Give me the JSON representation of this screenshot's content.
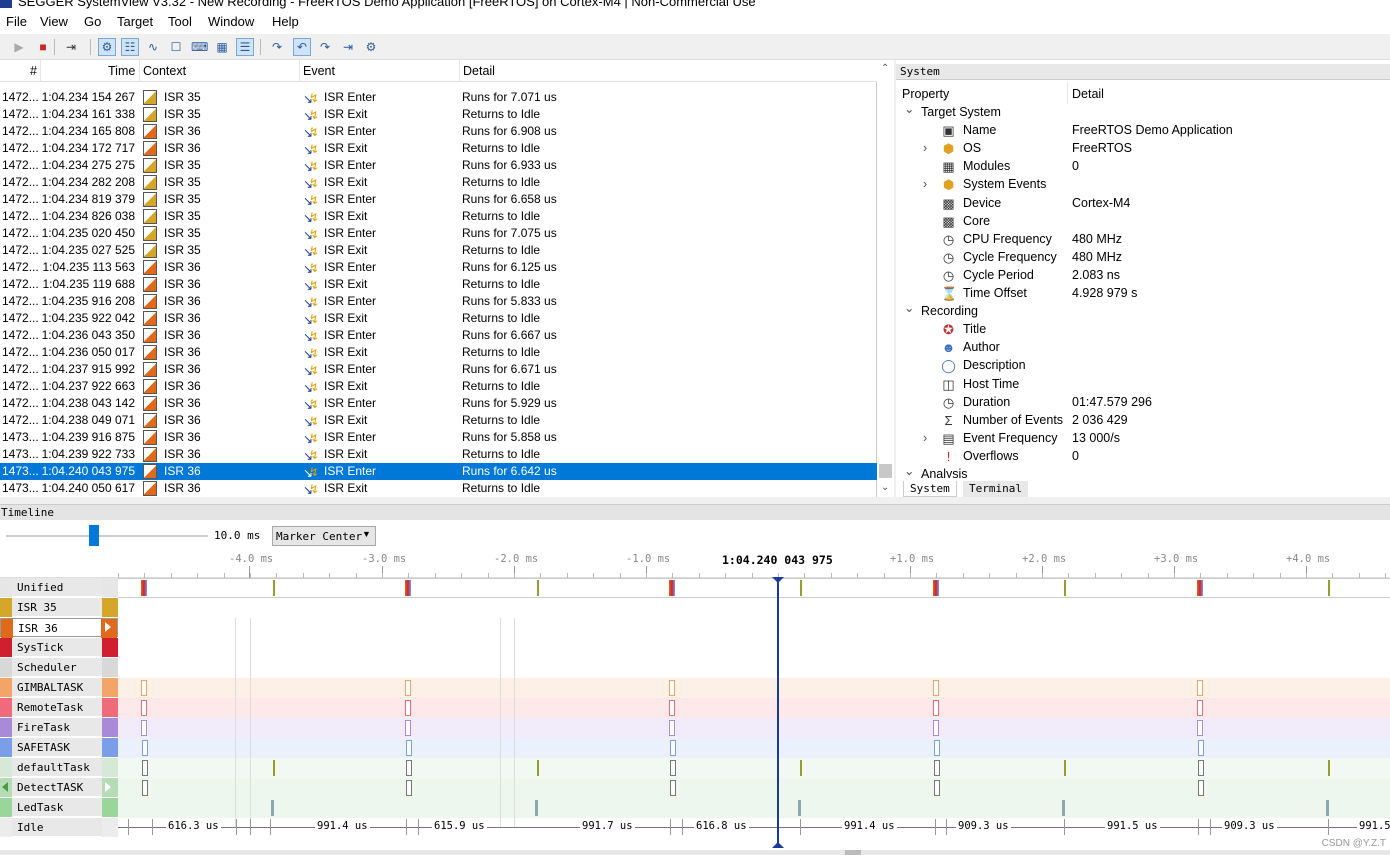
{
  "window": {
    "title": "SEGGER SystemView V3.32 - New Recording - FreeRTOS Demo Application [FreeRTOS] on Cortex-M4 | Non-Commercial Use"
  },
  "menu": [
    "File",
    "View",
    "Go",
    "Target",
    "Tool",
    "Window",
    "Help"
  ],
  "toolbar": [
    "play-icon",
    "stop-icon",
    "step-icon",
    "system-icon",
    "events-icon",
    "timeline-icon",
    "context-icon",
    "terminal-icon",
    "cpu-icon",
    "table-icon",
    "go-forward-icon",
    "go-prev-icon",
    "go-next-icon",
    "go-last-icon",
    "settings-icon"
  ],
  "events": {
    "columns": [
      "#",
      "Time",
      "Context",
      "Event",
      "Detail"
    ],
    "rows": [
      {
        "num": "1472...",
        "time": "1:04.234 154 267",
        "ctx": "ISR 35",
        "event": "ISR Enter",
        "detail": "Runs for 7.071 us"
      },
      {
        "num": "1472...",
        "time": "1:04.234 161 338",
        "ctx": "ISR 35",
        "event": "ISR Exit",
        "detail": "Returns to Idle"
      },
      {
        "num": "1472...",
        "time": "1:04.234 165 808",
        "ctx": "ISR 36",
        "event": "ISR Enter",
        "detail": "Runs for 6.908 us"
      },
      {
        "num": "1472...",
        "time": "1:04.234 172 717",
        "ctx": "ISR 36",
        "event": "ISR Exit",
        "detail": "Returns to Idle"
      },
      {
        "num": "1472...",
        "time": "1:04.234 275 275",
        "ctx": "ISR 35",
        "event": "ISR Enter",
        "detail": "Runs for 6.933 us"
      },
      {
        "num": "1472...",
        "time": "1:04.234 282 208",
        "ctx": "ISR 35",
        "event": "ISR Exit",
        "detail": "Returns to Idle"
      },
      {
        "num": "1472...",
        "time": "1:04.234 819 379",
        "ctx": "ISR 35",
        "event": "ISR Enter",
        "detail": "Runs for 6.658 us"
      },
      {
        "num": "1472...",
        "time": "1:04.234 826 038",
        "ctx": "ISR 35",
        "event": "ISR Exit",
        "detail": "Returns to Idle"
      },
      {
        "num": "1472...",
        "time": "1:04.235 020 450",
        "ctx": "ISR 35",
        "event": "ISR Enter",
        "detail": "Runs for 7.075 us"
      },
      {
        "num": "1472...",
        "time": "1:04.235 027 525",
        "ctx": "ISR 35",
        "event": "ISR Exit",
        "detail": "Returns to Idle"
      },
      {
        "num": "1472...",
        "time": "1:04.235 113 563",
        "ctx": "ISR 36",
        "event": "ISR Enter",
        "detail": "Runs for 6.125 us"
      },
      {
        "num": "1472...",
        "time": "1:04.235 119 688",
        "ctx": "ISR 36",
        "event": "ISR Exit",
        "detail": "Returns to Idle"
      },
      {
        "num": "1472...",
        "time": "1:04.235 916 208",
        "ctx": "ISR 36",
        "event": "ISR Enter",
        "detail": "Runs for 5.833 us"
      },
      {
        "num": "1472...",
        "time": "1:04.235 922 042",
        "ctx": "ISR 36",
        "event": "ISR Exit",
        "detail": "Returns to Idle"
      },
      {
        "num": "1472...",
        "time": "1:04.236 043 350",
        "ctx": "ISR 36",
        "event": "ISR Enter",
        "detail": "Runs for 6.667 us"
      },
      {
        "num": "1472...",
        "time": "1:04.236 050 017",
        "ctx": "ISR 36",
        "event": "ISR Exit",
        "detail": "Returns to Idle"
      },
      {
        "num": "1472...",
        "time": "1:04.237 915 992",
        "ctx": "ISR 36",
        "event": "ISR Enter",
        "detail": "Runs for 6.671 us"
      },
      {
        "num": "1472...",
        "time": "1:04.237 922 663",
        "ctx": "ISR 36",
        "event": "ISR Exit",
        "detail": "Returns to Idle"
      },
      {
        "num": "1472...",
        "time": "1:04.238 043 142",
        "ctx": "ISR 36",
        "event": "ISR Enter",
        "detail": "Runs for 5.929 us"
      },
      {
        "num": "1472...",
        "time": "1:04.238 049 071",
        "ctx": "ISR 36",
        "event": "ISR Exit",
        "detail": "Returns to Idle"
      },
      {
        "num": "1473...",
        "time": "1:04.239 916 875",
        "ctx": "ISR 36",
        "event": "ISR Enter",
        "detail": "Runs for 5.858 us"
      },
      {
        "num": "1473...",
        "time": "1:04.239 922 733",
        "ctx": "ISR 36",
        "event": "ISR Exit",
        "detail": "Returns to Idle"
      },
      {
        "num": "1473...",
        "time": "1:04.240 043 975",
        "ctx": "ISR 36",
        "event": "ISR Enter",
        "detail": "Runs for 6.642 us",
        "selected": true
      },
      {
        "num": "1473...",
        "time": "1:04.240 050 617",
        "ctx": "ISR 36",
        "event": "ISR Exit",
        "detail": "Returns to Idle"
      }
    ]
  },
  "system": {
    "panel_title": "System",
    "columns": [
      "Property",
      "Detail"
    ],
    "rows": [
      {
        "indent": 0,
        "expander": "v",
        "icon": "",
        "prop": "Target System",
        "val": ""
      },
      {
        "indent": 1,
        "expander": "",
        "icon": "monitor-icon",
        "prop": "Name",
        "val": "FreeRTOS Demo Application"
      },
      {
        "indent": 1,
        "expander": ">",
        "icon": "cube-icon",
        "prop": "OS",
        "val": "FreeRTOS"
      },
      {
        "indent": 1,
        "expander": "",
        "icon": "modules-icon",
        "prop": "Modules",
        "val": "0"
      },
      {
        "indent": 1,
        "expander": ">",
        "icon": "cube-icon",
        "prop": "System Events",
        "val": ""
      },
      {
        "indent": 1,
        "expander": "",
        "icon": "chip-icon",
        "prop": "Device",
        "val": "Cortex-M4"
      },
      {
        "indent": 1,
        "expander": "",
        "icon": "chip-icon",
        "prop": "Core",
        "val": ""
      },
      {
        "indent": 1,
        "expander": "",
        "icon": "clock-icon",
        "prop": "CPU Frequency",
        "val": "480 MHz"
      },
      {
        "indent": 1,
        "expander": "",
        "icon": "clock-icon",
        "prop": "Cycle Frequency",
        "val": "480 MHz"
      },
      {
        "indent": 1,
        "expander": "",
        "icon": "clock-icon",
        "prop": "Cycle Period",
        "val": "2.083 ns"
      },
      {
        "indent": 1,
        "expander": "",
        "icon": "hourglass-icon",
        "prop": "Time Offset",
        "val": "4.928 979 s"
      },
      {
        "indent": 0,
        "expander": "v",
        "icon": "",
        "prop": "Recording",
        "val": ""
      },
      {
        "indent": 1,
        "expander": "",
        "icon": "title-icon",
        "prop": "Title",
        "val": ""
      },
      {
        "indent": 1,
        "expander": "",
        "icon": "person-icon",
        "prop": "Author",
        "val": ""
      },
      {
        "indent": 1,
        "expander": "",
        "icon": "speech-bubble-icon",
        "prop": "Description",
        "val": ""
      },
      {
        "indent": 1,
        "expander": "",
        "icon": "host-icon",
        "prop": "Host Time",
        "val": ""
      },
      {
        "indent": 1,
        "expander": "",
        "icon": "clock-icon",
        "prop": "Duration",
        "val": "01:47.579 296"
      },
      {
        "indent": 1,
        "expander": "",
        "icon": "sigma-icon",
        "prop": "Number of Events",
        "val": "2 036 429"
      },
      {
        "indent": 1,
        "expander": ">",
        "icon": "chart-icon",
        "prop": "Event Frequency",
        "val": "13 000/s"
      },
      {
        "indent": 1,
        "expander": "",
        "icon": "exclamation-icon",
        "prop": "Overflows",
        "val": "0"
      },
      {
        "indent": 0,
        "expander": "v",
        "icon": "",
        "prop": "Analysis",
        "val": ""
      }
    ],
    "tabs": [
      "System",
      "Terminal"
    ]
  },
  "timeline": {
    "title": "Timeline",
    "zoom": "10.0 ms",
    "marker_mode": "Marker Center",
    "cursor_time": "1:04.240 043 975",
    "axis": [
      "-4.0 ms",
      "-3.0 ms",
      "-2.0 ms",
      "-1.0 ms",
      "+1.0 ms",
      "+2.0 ms",
      "+3.0 ms",
      "+4.0 ms"
    ],
    "tracks": [
      {
        "name": "Unified",
        "color": "#e6e6e6"
      },
      {
        "name": "ISR 35",
        "color": "#d4a62a"
      },
      {
        "name": "ISR 36",
        "color": "#e06a1a"
      },
      {
        "name": "SysTick",
        "color": "#d02030"
      },
      {
        "name": "Scheduler",
        "color": "#d8d8d8"
      },
      {
        "name": "GIMBALTASK",
        "color": "#f5a468"
      },
      {
        "name": "RemoteTask",
        "color": "#ef6a7a"
      },
      {
        "name": "FireTask",
        "color": "#a98ad8"
      },
      {
        "name": "SAFETASK",
        "color": "#7a9ee8"
      },
      {
        "name": "defaultTask",
        "color": "#d6e8d6"
      },
      {
        "name": "DetectTASK",
        "color": "#b6dcb6"
      },
      {
        "name": "LedTask",
        "color": "#9ad69a"
      },
      {
        "name": "Idle",
        "color": "#ececec"
      }
    ],
    "idle_labels": [
      "616.3 us",
      "991.4 us",
      "615.9 us",
      "991.7 us",
      "616.8 us",
      "991.4 us",
      "909.3 us",
      "991.5 us",
      "909.3 us",
      "991.5"
    ]
  },
  "watermark": "CSDN @Y.Z.T"
}
